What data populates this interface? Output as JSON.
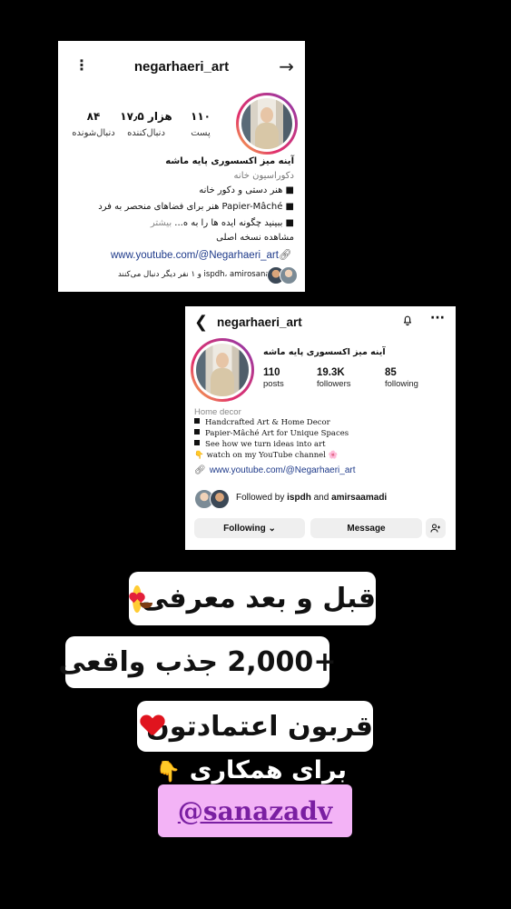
{
  "card1": {
    "username": "negarhaeri_art",
    "stats": [
      {
        "value": "۱۱۰",
        "label": "پست"
      },
      {
        "value": "۱۷٫۵ هزار",
        "label": "دنبال‌کننده"
      },
      {
        "value": "۸۴",
        "label": "دنبال‌شونده"
      }
    ],
    "name": "آینه میز اکسسوری پایه ماشه",
    "category": "دکوراسیون خانه",
    "bio1": "■ هنر دستی و دکور خانه",
    "bio2": "■ Papier-Mâché هنر برای فضاهای منحصر به فرد",
    "bio3": "■ ببینید چگونه ایده ها را به ه...",
    "more": " بیشتر",
    "translate": "مشاهده نسخه اصلی",
    "link": "www.youtube.com/@Negarhaeri_art",
    "followed_by": "ispdh، amirosanaz و ۱ نفر دیگر دنبال می‌کنند"
  },
  "card2": {
    "username": "negarhaeri_art",
    "name": "آینه میز اکسسوری پایه ماشه",
    "stats": [
      {
        "value": "110",
        "label": "posts"
      },
      {
        "value": "19.3K",
        "label": "followers"
      },
      {
        "value": "85",
        "label": "following"
      }
    ],
    "category": "Home decor",
    "bio1": "Handcrafted Art & Home Decor",
    "bio2": "Papier-Mâché Art for Unique Spaces",
    "bio3": "See how we turn ideas into art",
    "bio4": "watch on my YouTube channel 🌸",
    "link": "www.youtube.com/@Negarhaeri_art",
    "followed_prefix": "Followed by ",
    "followed_user1": "ispdh",
    "followed_and": " and ",
    "followed_user2": "amirsaamadi",
    "following_label": "Following ⌄",
    "message_label": "Message"
  },
  "labels": {
    "line1": "قبل و بعد معرفی",
    "line2": "+2,000 جذب واقعی",
    "line3": "قربون اعتمادتون",
    "line4": "برای همکاری",
    "handle": "@sanazadv"
  },
  "icons": {
    "back": "chevron-left-icon",
    "bell": "bell-icon",
    "more": "more-icon",
    "arrow": "arrow-right-icon",
    "heart": "heart-icon",
    "smiley": "heart-eyes-icon",
    "hand": "pointing-down-icon"
  },
  "colors": {
    "background": "#000000",
    "link": "#1e3a8a",
    "handle_bg": "#f3b3f6",
    "handle_text": "#7a1fa2"
  }
}
